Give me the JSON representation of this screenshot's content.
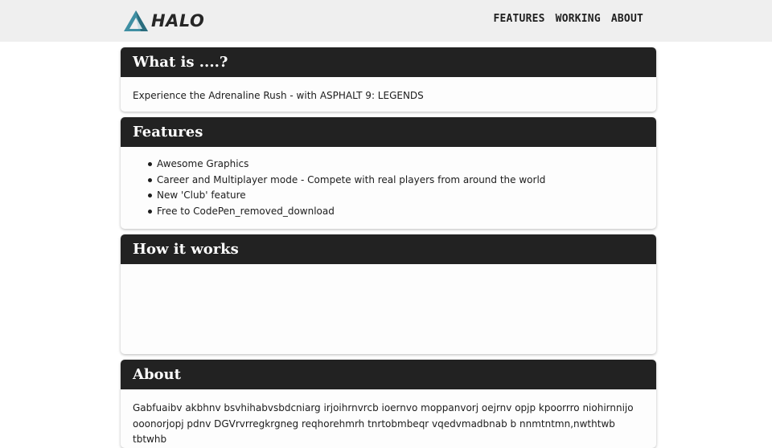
{
  "header": {
    "brand": "HALO",
    "nav": [
      "FEATURES",
      "WORKING",
      "ABOUT"
    ]
  },
  "sections": {
    "what": {
      "title": "What is ....?",
      "text": "Experience the Adrenaline Rush - with ASPHALT 9: LEGENDS"
    },
    "features": {
      "title": "Features",
      "items": [
        "Awesome Graphics",
        "Career and Multiplayer mode - Compete with real players from around the world",
        "New 'Club' feature",
        "Free to CodePen_removed_download"
      ]
    },
    "how": {
      "title": "How it works"
    },
    "about": {
      "title": "About",
      "text": "Gabfuaibv akbhnv bsvhihabvsbdcniarg irjoihrnvrcb ioernvo moppanvorj oejrnv opjp kpoorrro niohirnnijo ooonorjopj pdnv DGVrvrregkrgneg reqhorehmrh tnrtobmbeqr vqedvmadbnab b nnmtntmn,nwthtwb tbtwhb"
    }
  },
  "colors": {
    "topbar": "#efefef",
    "card_header": "#222222",
    "logo_accent": "#3f8fa3"
  }
}
